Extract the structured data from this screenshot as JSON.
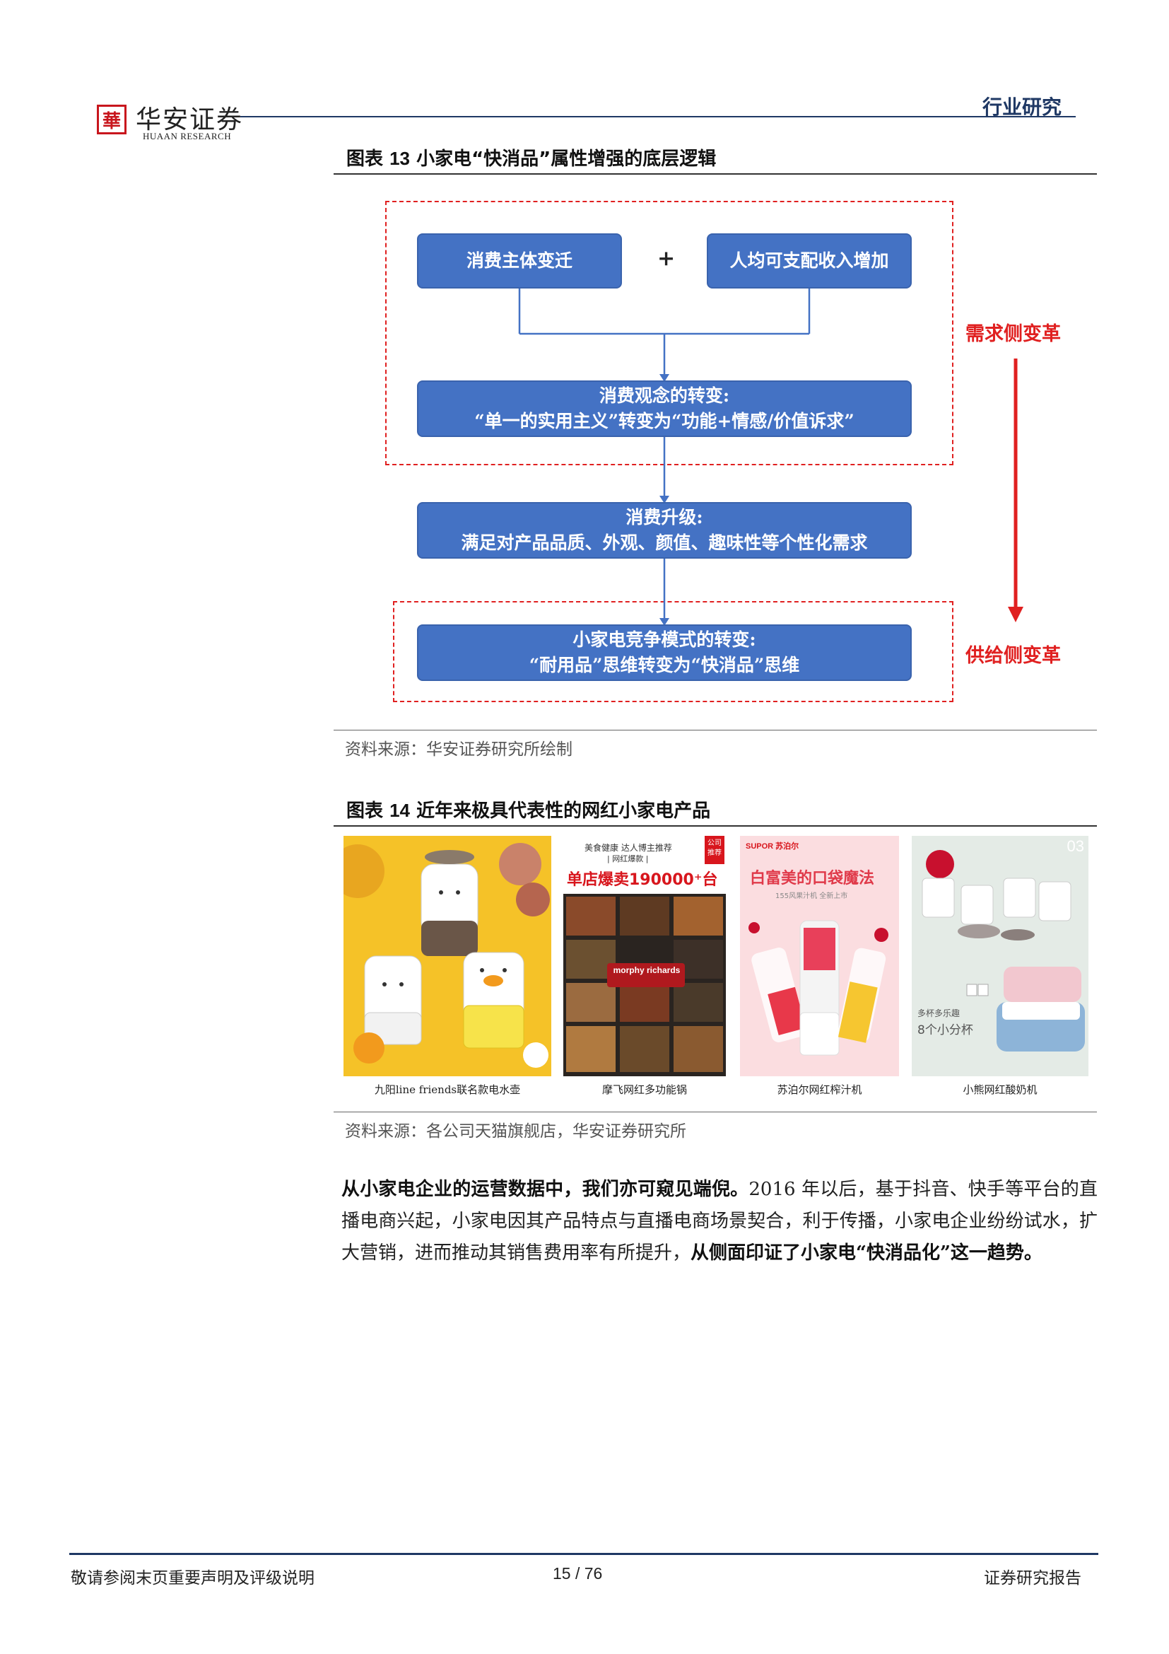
{
  "header": {
    "logo_cn": "华安证券",
    "logo_en": "HUAAN RESEARCH",
    "section": "行业研究"
  },
  "figure13": {
    "title_prefix": "图表",
    "title_num": "13",
    "title_text": "小家电“快消品”属性增强的底层逻辑",
    "boxes": {
      "subject_change": "消费主体变迁",
      "plus": "+",
      "income_increase": "人均可支配收入增加",
      "concept_line1": "消费观念的转变:",
      "concept_line2": "“单一的实用主义”转变为“功能+情感/价值诉求”",
      "upgrade_line1": "消费升级:",
      "upgrade_line2": "满足对产品品质、外观、颜值、趣味性等个性化需求",
      "competition_line1": "小家电竞争模式的转变:",
      "competition_line2": "“耐用品”思维转变为“快消品”思维"
    },
    "demand_label": "需求侧变革",
    "supply_label": "供给侧变革",
    "source": "资料来源：华安证券研究所绘制"
  },
  "figure14": {
    "title_prefix": "图表",
    "title_num": "14",
    "title_text": "近年来极具代表性的网红小家电产品",
    "products": [
      {
        "caption": "九阳line friends联名款电水壶"
      },
      {
        "caption": "摩飞网红多功能锅",
        "banner_top": "美食健康 达人博主推荐",
        "banner_sub": "| 网红爆款 |",
        "headline": "单店爆卖190000⁺台",
        "badge": "公司 推荐",
        "brand": "morphy richards"
      },
      {
        "caption": "苏泊尔网红榨汁机",
        "brand": "SUPOR 苏泊尔",
        "headline": "白富美的口袋魔法",
        "sub": "155风果汁机 全新上市"
      },
      {
        "caption": "小熊网红酸奶机",
        "corner": "03",
        "text1": "多杯多乐趣",
        "text2": "8个小分杯"
      }
    ],
    "source": "资料来源：各公司天猫旗舰店，华安证券研究所"
  },
  "body": {
    "bold1": "从小家电企业的运营数据中，我们亦可窥见端倪。",
    "normal1": "2016 年以后，基于抖音、快手等平台的直播电商兴起，小家电因其产品特点与直播电商场景契合，利于传播，小家电企业纷纷试水，扩大营销，进而推动其销售费用率有所提升，",
    "bold2": "从侧面印证了小家电“快消品化”这一趋势。"
  },
  "footer": {
    "left": "敬请参阅末页重要声明及评级说明",
    "page": "15 / 76",
    "right": "证券研究报告"
  },
  "colors": {
    "box_blue": "#4472c4",
    "accent_red": "#e02020",
    "brand_navy": "#1f3864"
  }
}
